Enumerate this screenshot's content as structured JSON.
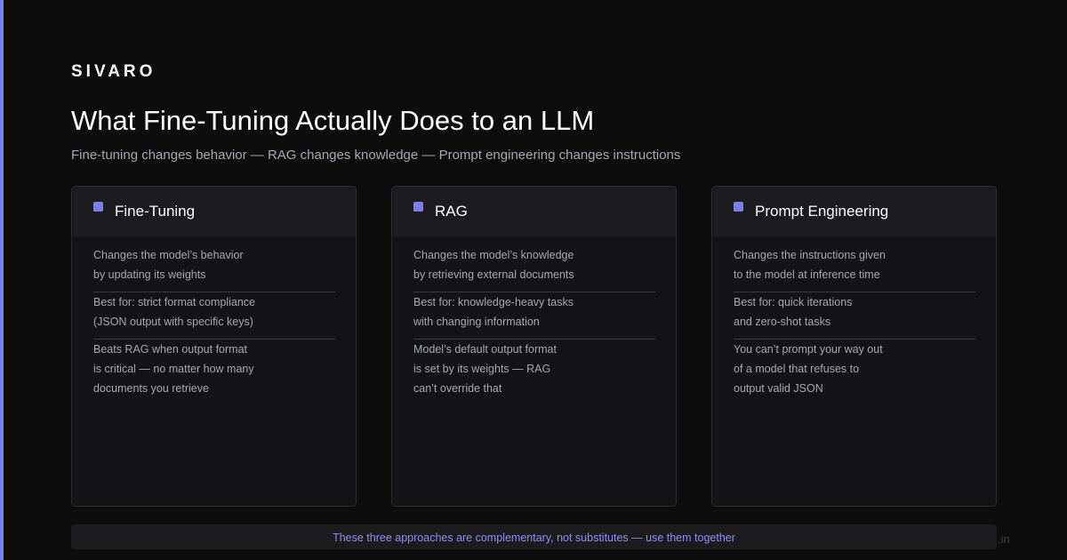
{
  "brand": "SIVARO",
  "title": "What Fine-Tuning Actually Does to an LLM",
  "subtitle": "Fine-tuning changes behavior — RAG changes knowledge — Prompt engineering changes instructions",
  "colors": {
    "accent": "#7b7ff0",
    "background": "#0d0d0e",
    "card": "#141416",
    "card_header": "#1c1c1f",
    "footer_text": "#8b8ff5"
  },
  "cards": [
    {
      "title": "Fine-Tuning",
      "marker_icon": "square-bullet-icon",
      "sections": [
        {
          "line1": "Changes the model’s behavior",
          "line2": "by updating its weights",
          "line3": ""
        },
        {
          "line1": "Best for: strict format compliance",
          "line2": "(JSON output with specific keys)",
          "line3": ""
        },
        {
          "line1": "Beats RAG when output format",
          "line2": "is critical — no matter how many",
          "line3": "documents you retrieve"
        }
      ]
    },
    {
      "title": "RAG",
      "marker_icon": "square-bullet-icon",
      "sections": [
        {
          "line1": "Changes the model’s knowledge",
          "line2": "by retrieving external documents",
          "line3": ""
        },
        {
          "line1": "Best for: knowledge-heavy tasks",
          "line2": "with changing information",
          "line3": ""
        },
        {
          "line1": "Model’s default output format",
          "line2": "is set by its weights — RAG",
          "line3": "can’t override that"
        }
      ]
    },
    {
      "title": "Prompt Engineering",
      "marker_icon": "square-bullet-icon",
      "sections": [
        {
          "line1": "Changes the instructions given",
          "line2": "to the model at inference time",
          "line3": ""
        },
        {
          "line1": "Best for: quick iterations",
          "line2": "and zero-shot tasks",
          "line3": ""
        },
        {
          "line1": "You can’t prompt your way out",
          "line2": "of a model that refuses to",
          "line3": "output valid JSON"
        }
      ]
    }
  ],
  "footer": "These three approaches are complementary, not substitutes — use them together",
  "corner_text": ".in"
}
